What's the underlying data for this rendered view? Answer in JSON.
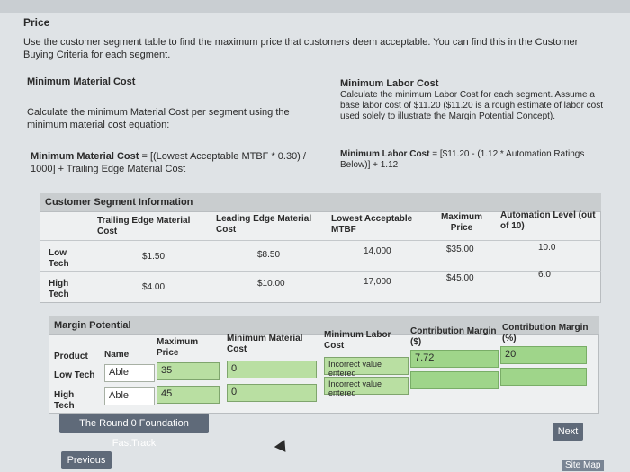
{
  "header": {
    "title": "Price",
    "instructions": "Use the customer segment table to find the maximum price that customers deem acceptable. You can find this in the Customer Buying Criteria for each segment."
  },
  "material": {
    "heading": "Minimum Material Cost",
    "description": "Calculate the minimum Material Cost per segment using the minimum material cost equation:",
    "formula_label": "Minimum Material Cost",
    "formula_text": " = [(Lowest Acceptable MTBF * 0.30) / 1000] + Trailing Edge Material Cost"
  },
  "labor": {
    "heading": "Minimum Labor Cost",
    "description": "Calculate the minimum Labor Cost for each segment. Assume a base labor cost of $11.20 ($11.20 is a rough estimate of labor cost used solely to illustrate the Margin Potential Concept).",
    "formula_label": "Minimum Labor Cost",
    "formula_text": " = [$11.20 - (1.12 * Automation Ratings Below)] + 1.12"
  },
  "segment_table": {
    "title": "Customer Segment Information",
    "headers": [
      "Trailing Edge Material Cost",
      "Leading Edge Material Cost",
      "Lowest Acceptable MTBF",
      "Maximum Price",
      "Automation Level (out of 10)"
    ],
    "rows": [
      {
        "segment": "Low Tech",
        "trailing": "$1.50",
        "leading": "$8.50",
        "mtbf": "14,000",
        "price": "$35.00",
        "automation": "10.0"
      },
      {
        "segment": "High Tech",
        "trailing": "$4.00",
        "leading": "$10.00",
        "mtbf": "17,000",
        "price": "$45.00",
        "automation": "6.0"
      }
    ]
  },
  "margin_table": {
    "title": "Margin Potential",
    "headers": {
      "product": "Product",
      "name": "Name",
      "max_price": "Maximum Price",
      "min_material": "Minimum Material Cost",
      "min_labor": "Minimum Labor Cost",
      "cm_dollar": "Contribution Margin ($)",
      "cm_pct": "Contribution Margin (%)"
    },
    "rows": [
      {
        "segment": "Low Tech",
        "name": "Able",
        "max_price": "35",
        "min_material": "0",
        "min_labor_msg": "Incorrect value entered",
        "cm_dollar": "7.72",
        "cm_pct": "20"
      },
      {
        "segment": "High Tech",
        "name": "Able",
        "max_price": "45",
        "min_material": "0",
        "min_labor_msg": "Incorrect value entered",
        "cm_dollar": "",
        "cm_pct": ""
      }
    ]
  },
  "buttons": {
    "fasttrack": "The Round 0 Foundation FastTrack",
    "next": "Next",
    "previous": "Previous"
  },
  "footer": {
    "site_map": "Site Map"
  }
}
